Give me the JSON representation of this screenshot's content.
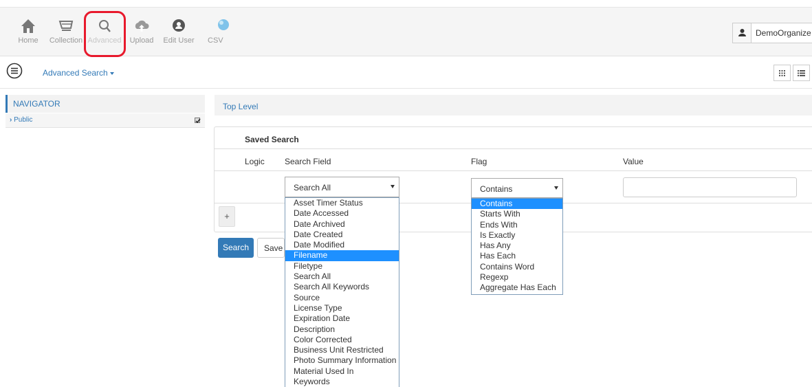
{
  "toolbar": {
    "items": [
      {
        "label": "Home",
        "icon": "home-icon"
      },
      {
        "label": "Collection",
        "icon": "cart-icon"
      },
      {
        "label": "Advanced",
        "icon": "search-icon"
      },
      {
        "label": "Upload",
        "icon": "upload-cloud-icon"
      },
      {
        "label": "Edit User",
        "icon": "user-circle-icon"
      },
      {
        "label": "CSV",
        "icon": "globe-icon"
      }
    ],
    "user": "DemoOrganize",
    "highlight_color": "#e8192c"
  },
  "subbar": {
    "title": "Advanced Search"
  },
  "sidebar": {
    "header": "NAVIGATOR",
    "items": [
      {
        "label": "Public",
        "checked": true
      }
    ]
  },
  "breadcrumb": "Top Level",
  "saved_search": {
    "title": "Saved Search",
    "columns": [
      "Logic",
      "Search Field",
      "Flag",
      "Value"
    ],
    "search_field_value": "Search All",
    "flag_value": "Contains",
    "value": ""
  },
  "buttons": {
    "add": "+",
    "search": "Search",
    "save": "Save"
  },
  "search_field_options": [
    "Asset Timer Status",
    "Date Accessed",
    "Date Archived",
    "Date Created",
    "Date Modified",
    "Filename",
    "Filetype",
    "Search All",
    "Search All Keywords",
    "Source",
    "License Type",
    "Expiration Date",
    "Description",
    "Color Corrected",
    "Business Unit Restricted",
    "Photo Summary Information",
    "Material Used In",
    "Keywords"
  ],
  "search_field_highlighted": "Filename",
  "flag_options": [
    "Contains",
    "Starts With",
    "Ends With",
    "Is Exactly",
    "Has Any",
    "Has Each",
    "Contains Word",
    "Regexp",
    "Aggregate Has Each"
  ],
  "flag_highlighted": "Contains",
  "colors": {
    "accent": "#337ab7",
    "selected": "#1e90ff"
  }
}
